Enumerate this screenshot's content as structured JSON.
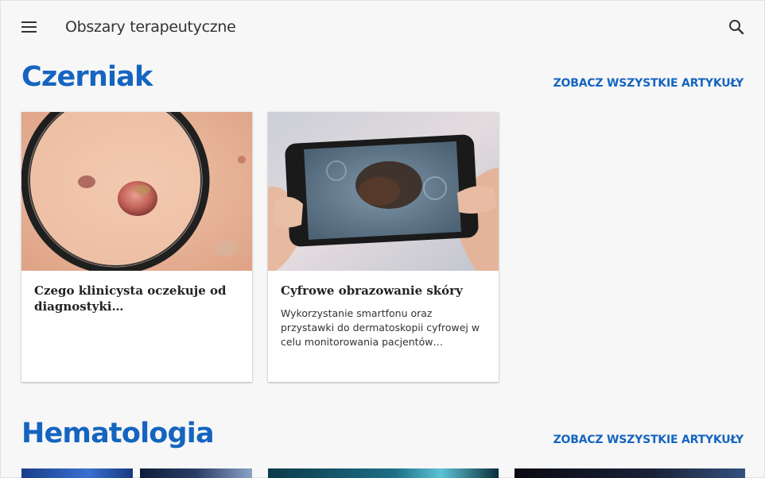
{
  "header": {
    "title": "Obszary terapeutyczne",
    "menu_icon": "hamburger-menu-icon",
    "search_icon": "search-icon"
  },
  "sections": [
    {
      "title": "Czerniak",
      "see_all": "ZOBACZ WSZYSTKIE ARTYKUŁY",
      "cards": [
        {
          "title": "Czego klinicysta oczekuje od diagnostyki patomorfologicznej i…",
          "description": ""
        },
        {
          "title": "Cyfrowe obrazowanie skóry",
          "description": "Wykorzystanie smartfonu oraz przystawki do dermatoskopii cyfrowej w celu monitorowania pacjentów leczonych…"
        }
      ]
    },
    {
      "title": "Hematologia",
      "see_all": "ZOBACZ WSZYSTKIE ARTYKUŁY"
    }
  ],
  "colors": {
    "accent": "#1565c0",
    "background": "#f7f7f7",
    "card": "#ffffff"
  }
}
